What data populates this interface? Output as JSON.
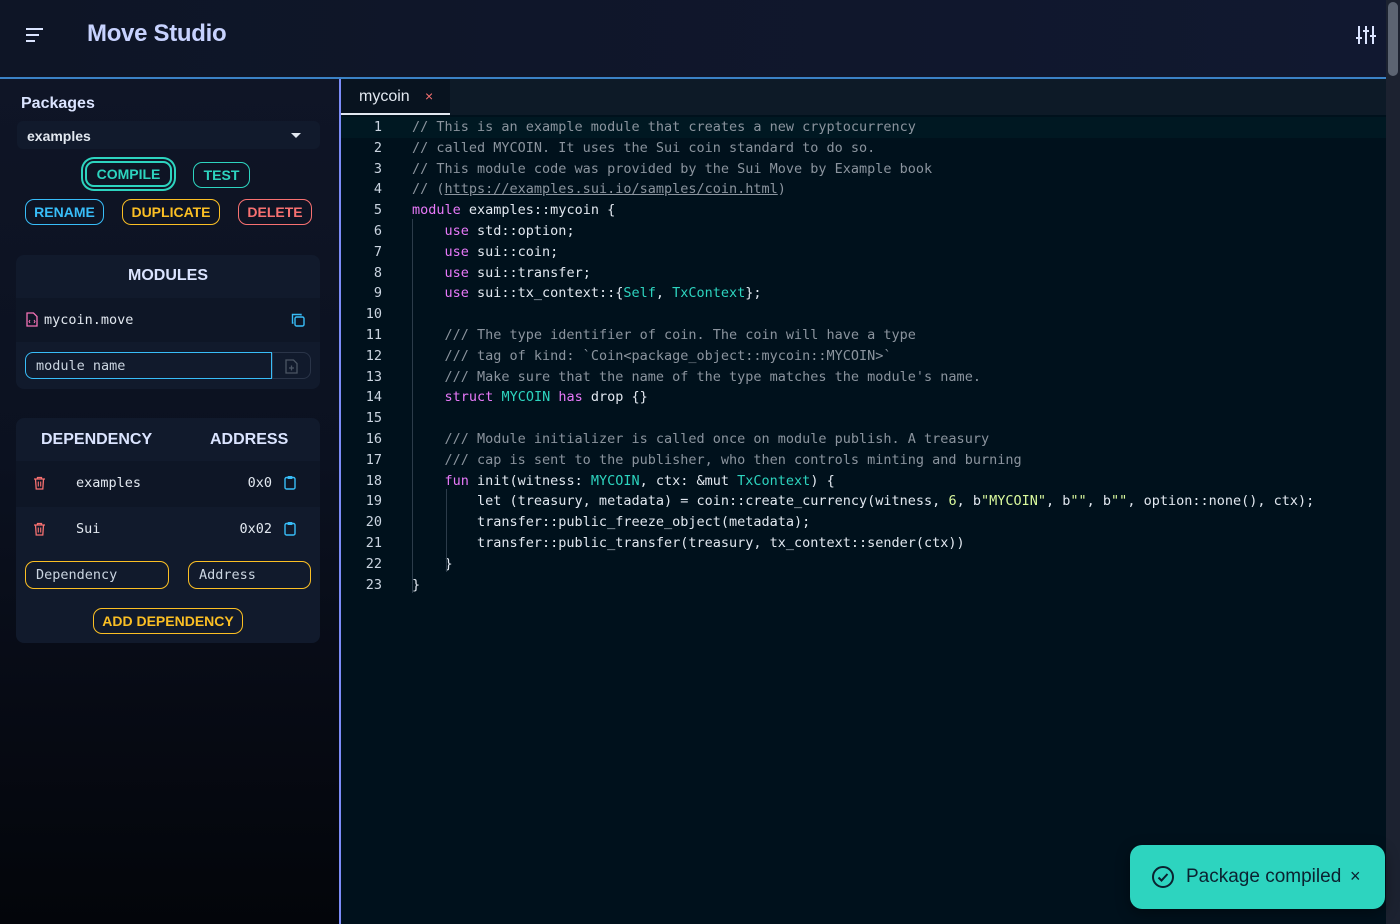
{
  "header": {
    "title": "Move Studio",
    "menu_icon": "hamburger-menu-icon",
    "settings_icon": "sliders-icon"
  },
  "sidebar": {
    "packages_label": "Packages",
    "selected_package": "examples",
    "buttons": {
      "compile": "COMPILE",
      "test": "TEST",
      "rename": "RENAME",
      "duplicate": "DUPLICATE",
      "delete": "DELETE"
    },
    "modules": {
      "title": "MODULES",
      "items": [
        {
          "name": "mycoin.move"
        }
      ],
      "input_placeholder": "module name"
    },
    "dependencies": {
      "header_dependency": "DEPENDENCY",
      "header_address": "ADDRESS",
      "items": [
        {
          "name": "examples",
          "address": "0x0"
        },
        {
          "name": "Sui",
          "address": "0x02"
        }
      ],
      "dependency_placeholder": "Dependency",
      "address_placeholder": "Address",
      "add_button": "ADD DEPENDENCY"
    }
  },
  "editor": {
    "tab": {
      "label": "mycoin",
      "close": "×"
    },
    "current_line": 1,
    "line_numbers": [
      "1",
      "2",
      "3",
      "4",
      "5",
      "6",
      "7",
      "8",
      "9",
      "10",
      "11",
      "12",
      "13",
      "14",
      "15",
      "16",
      "17",
      "18",
      "19",
      "20",
      "21",
      "22",
      "23"
    ],
    "lines": [
      [
        {
          "c": "c",
          "t": "// This is an example module that creates a new cryptocurrency"
        }
      ],
      [
        {
          "c": "c",
          "t": "// called MYCOIN. It uses the Sui coin standard to do so."
        }
      ],
      [
        {
          "c": "c",
          "t": "// This module code was provided by the Sui Move by Example book"
        }
      ],
      [
        {
          "c": "c",
          "t": "// ("
        },
        {
          "c": "c u",
          "t": "https://examples.sui.io/samples/coin.html"
        },
        {
          "c": "c",
          "t": ")"
        }
      ],
      [
        {
          "c": "k",
          "t": "module"
        },
        {
          "c": "",
          "t": " examples::mycoin {"
        }
      ],
      [
        {
          "c": "",
          "t": "    "
        },
        {
          "c": "k",
          "t": "use"
        },
        {
          "c": "",
          "t": " std::option;"
        }
      ],
      [
        {
          "c": "",
          "t": "    "
        },
        {
          "c": "k",
          "t": "use"
        },
        {
          "c": "",
          "t": " sui::coin;"
        }
      ],
      [
        {
          "c": "",
          "t": "    "
        },
        {
          "c": "k",
          "t": "use"
        },
        {
          "c": "",
          "t": " sui::transfer;"
        }
      ],
      [
        {
          "c": "",
          "t": "    "
        },
        {
          "c": "k",
          "t": "use"
        },
        {
          "c": "",
          "t": " sui::tx_context::{"
        },
        {
          "c": "t",
          "t": "Self"
        },
        {
          "c": "",
          "t": ", "
        },
        {
          "c": "t",
          "t": "TxContext"
        },
        {
          "c": "",
          "t": "};"
        }
      ],
      [
        {
          "c": "",
          "t": ""
        }
      ],
      [
        {
          "c": "",
          "t": "    "
        },
        {
          "c": "c",
          "t": "/// The type identifier of coin. The coin will have a type"
        }
      ],
      [
        {
          "c": "",
          "t": "    "
        },
        {
          "c": "c",
          "t": "/// tag of kind: `Coin<package_object::mycoin::MYCOIN>`"
        }
      ],
      [
        {
          "c": "",
          "t": "    "
        },
        {
          "c": "c",
          "t": "/// Make sure that the name of the type matches the module's name."
        }
      ],
      [
        {
          "c": "",
          "t": "    "
        },
        {
          "c": "k",
          "t": "struct"
        },
        {
          "c": "",
          "t": " "
        },
        {
          "c": "t",
          "t": "MYCOIN"
        },
        {
          "c": "",
          "t": " "
        },
        {
          "c": "k",
          "t": "has"
        },
        {
          "c": "",
          "t": " drop {}"
        }
      ],
      [
        {
          "c": "",
          "t": ""
        }
      ],
      [
        {
          "c": "",
          "t": "    "
        },
        {
          "c": "c",
          "t": "/// Module initializer is called once on module publish. A treasury"
        }
      ],
      [
        {
          "c": "",
          "t": "    "
        },
        {
          "c": "c",
          "t": "/// cap is sent to the publisher, who then controls minting and burning"
        }
      ],
      [
        {
          "c": "",
          "t": "    "
        },
        {
          "c": "k",
          "t": "fun"
        },
        {
          "c": "",
          "t": " init(witness: "
        },
        {
          "c": "t",
          "t": "MYCOIN"
        },
        {
          "c": "",
          "t": ", ctx: &mut "
        },
        {
          "c": "t",
          "t": "TxContext"
        },
        {
          "c": "",
          "t": ") {"
        }
      ],
      [
        {
          "c": "",
          "t": "        let (treasury, metadata) = coin::create_currency(witness, "
        },
        {
          "c": "s",
          "t": "6"
        },
        {
          "c": "",
          "t": ", b"
        },
        {
          "c": "s",
          "t": "\"MYCOIN\""
        },
        {
          "c": "",
          "t": ", b"
        },
        {
          "c": "s",
          "t": "\"\""
        },
        {
          "c": "",
          "t": ", b"
        },
        {
          "c": "s",
          "t": "\"\""
        },
        {
          "c": "",
          "t": ", option::none(), ctx);"
        }
      ],
      [
        {
          "c": "",
          "t": "        transfer::public_freeze_object(metadata);"
        }
      ],
      [
        {
          "c": "",
          "t": "        transfer::public_transfer(treasury, tx_context::sender(ctx))"
        }
      ],
      [
        {
          "c": "",
          "t": "    }"
        }
      ],
      [
        {
          "c": "",
          "t": "}"
        }
      ]
    ]
  },
  "toast": {
    "message": "Package compiled",
    "close": "×",
    "icon": "check-circle-icon"
  },
  "colors": {
    "accent_teal": "#2dd4bf",
    "accent_blue": "#38bdf8",
    "accent_yellow": "#fbbf24",
    "accent_red": "#f87171",
    "keyword": "#e879f9"
  }
}
